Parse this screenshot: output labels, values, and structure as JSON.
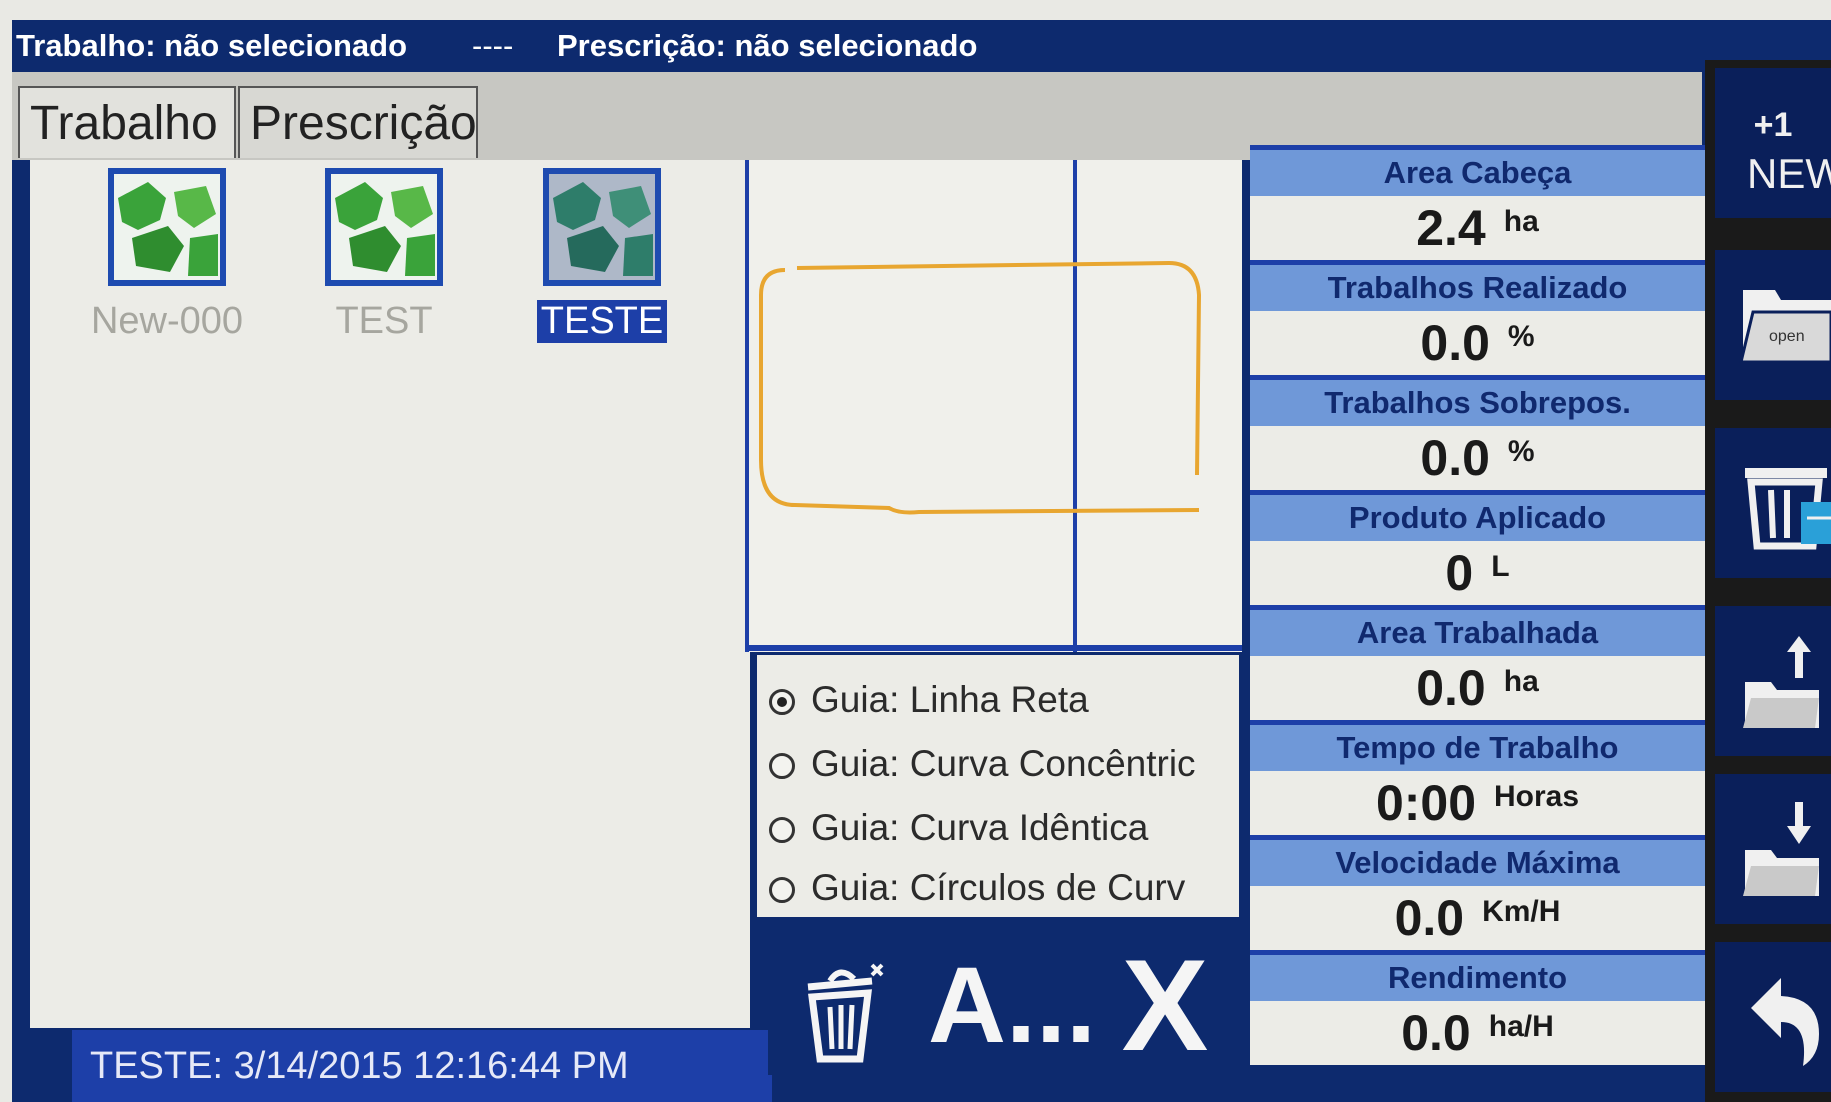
{
  "header": {
    "job_status": "Trabalho: não selecionado",
    "separator": "----",
    "prescription_status": "Prescrição: não selecionado"
  },
  "tabs": [
    {
      "label": "Trabalho",
      "active": true
    },
    {
      "label": "Prescrição",
      "active": false
    }
  ],
  "jobs": [
    {
      "name": "New-000",
      "selected": false
    },
    {
      "name": "TEST",
      "selected": false
    },
    {
      "name": "TESTE",
      "selected": true
    }
  ],
  "status_bar": "TESTE: 3/14/2015 12:16:44 PM",
  "guides": [
    {
      "label": "Guia: Linha Reta",
      "selected": true
    },
    {
      "label": "Guia: Curva Concêntric",
      "selected": false
    },
    {
      "label": "Guia: Curva Idêntica",
      "selected": false
    },
    {
      "label": "Guia: Círculos de Curv",
      "selected": false
    }
  ],
  "actions": {
    "delete_icon": "trash-icon",
    "rename_label": "A...",
    "close_label": "X"
  },
  "stats": [
    {
      "label": "Area Cabeça",
      "value": "2.4",
      "unit": "ha"
    },
    {
      "label": "Trabalhos Realizado",
      "value": "0.0",
      "unit": "%"
    },
    {
      "label": "Trabalhos Sobrepos.",
      "value": "0.0",
      "unit": "%"
    },
    {
      "label": "Produto Aplicado",
      "value": "0",
      "unit": "L"
    },
    {
      "label": "Area Trabalhada",
      "value": "0.0",
      "unit": "ha"
    },
    {
      "label": "Tempo de Trabalho",
      "value": "0:00",
      "unit": "Horas"
    },
    {
      "label": "Velocidade Máxima",
      "value": "0.0",
      "unit": "Km/H"
    },
    {
      "label": "Rendimento",
      "value": "0.0",
      "unit": "ha/H"
    }
  ],
  "sidebar": {
    "new_count": "+1",
    "new_label": "NEW",
    "open_label": "open"
  },
  "colors": {
    "accent": "#1d3fa8",
    "header_bg": "#0d2a6e",
    "stat_label_bg": "#6f98d8",
    "boundary": "#e8a630"
  }
}
